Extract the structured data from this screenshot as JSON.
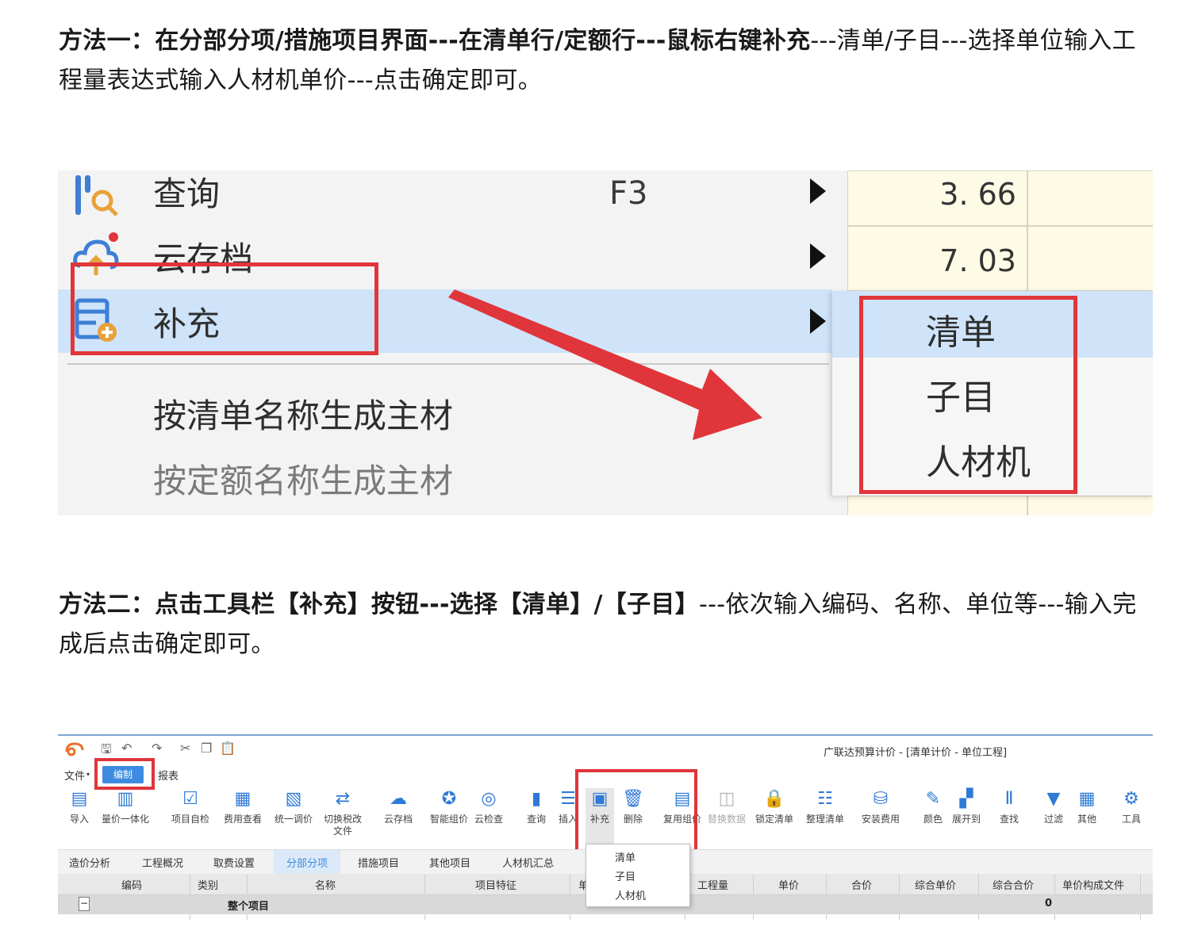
{
  "method1": {
    "bold": "方法一：在分部分项/措施项目界面---在清单行/定额行---鼠标右键补充",
    "normal": "---清单/子目---选择单位输入工程量表达式输入人材机单价---点击确定即可。"
  },
  "figure1": {
    "menu_items": [
      "查询",
      "云存档",
      "补充",
      "按清单名称生成主材",
      "按定额名称生成主材"
    ],
    "shortcut": "F3",
    "cell_values": [
      "3. 66",
      "7. 03"
    ],
    "submenu": [
      "清单",
      "子目",
      "人材机"
    ],
    "colors": {
      "highlight": "#cfe3f9",
      "red_annotation": "#e0353a",
      "cell_bg": "#fdfbe6"
    }
  },
  "method2": {
    "bold": "方法二：点击工具栏【补充】按钮---选择【清单】/【子目】",
    "normal": "---依次输入编码、名称、单位等---输入完成后点击确定即可。"
  },
  "figure2": {
    "window_title": "广联达预算计价 - [清单计价 - 单位工程]",
    "menus": [
      "文件",
      "编制",
      "报表"
    ],
    "toolbar": [
      {
        "label": "导入",
        "icon": "import-icon",
        "gray": false
      },
      {
        "label": "量价一体化",
        "icon": "integration-icon",
        "gray": false
      },
      {
        "label": "项目自检",
        "icon": "self-check-icon",
        "gray": false
      },
      {
        "label": "费用查看",
        "icon": "fee-view-icon",
        "gray": false
      },
      {
        "label": "统一调价",
        "icon": "price-adjust-icon",
        "gray": false
      },
      {
        "label": "切换税改\n文件",
        "icon": "tax-switch-icon",
        "gray": false
      },
      {
        "label": "云存档",
        "icon": "cloud-save-icon",
        "gray": false
      },
      {
        "label": "智能组价",
        "icon": "smart-price-icon",
        "gray": false
      },
      {
        "label": "云检查",
        "icon": "cloud-check-icon",
        "gray": false
      },
      {
        "label": "查询",
        "icon": "query-icon",
        "gray": false
      },
      {
        "label": "插入",
        "icon": "insert-icon",
        "gray": false
      },
      {
        "label": "补充",
        "icon": "supplement-icon",
        "gray": false
      },
      {
        "label": "删除",
        "icon": "delete-icon",
        "gray": false
      },
      {
        "label": "复用组价",
        "icon": "reuse-price-icon",
        "gray": false
      },
      {
        "label": "替换数据",
        "icon": "replace-data-icon",
        "gray": true
      },
      {
        "label": "锁定清单",
        "icon": "lock-icon",
        "gray": false
      },
      {
        "label": "整理清单",
        "icon": "organize-list-icon",
        "gray": false
      },
      {
        "label": "安装费用",
        "icon": "install-fee-icon",
        "gray": false
      },
      {
        "label": "颜色",
        "icon": "color-icon",
        "gray": false
      },
      {
        "label": "展开到",
        "icon": "expand-icon",
        "gray": false
      },
      {
        "label": "查找",
        "icon": "find-icon",
        "gray": false
      },
      {
        "label": "过滤",
        "icon": "filter-icon",
        "gray": false
      },
      {
        "label": "其他",
        "icon": "other-icon",
        "gray": false
      },
      {
        "label": "工具",
        "icon": "tools-icon",
        "gray": false
      }
    ],
    "tabs": [
      "造价分析",
      "工程概况",
      "取费设置",
      "分部分项",
      "措施项目",
      "其他项目",
      "人材机汇总"
    ],
    "columns": [
      "编码",
      "类别",
      "名称",
      "项目特征",
      "单",
      "工程量",
      "单价",
      "合价",
      "综合单价",
      "综合合价",
      "单价构成文件"
    ],
    "row": {
      "expander": "−",
      "name": "整个项目",
      "value": "0"
    },
    "dropdown": [
      "清单",
      "子目",
      "人材机"
    ]
  }
}
